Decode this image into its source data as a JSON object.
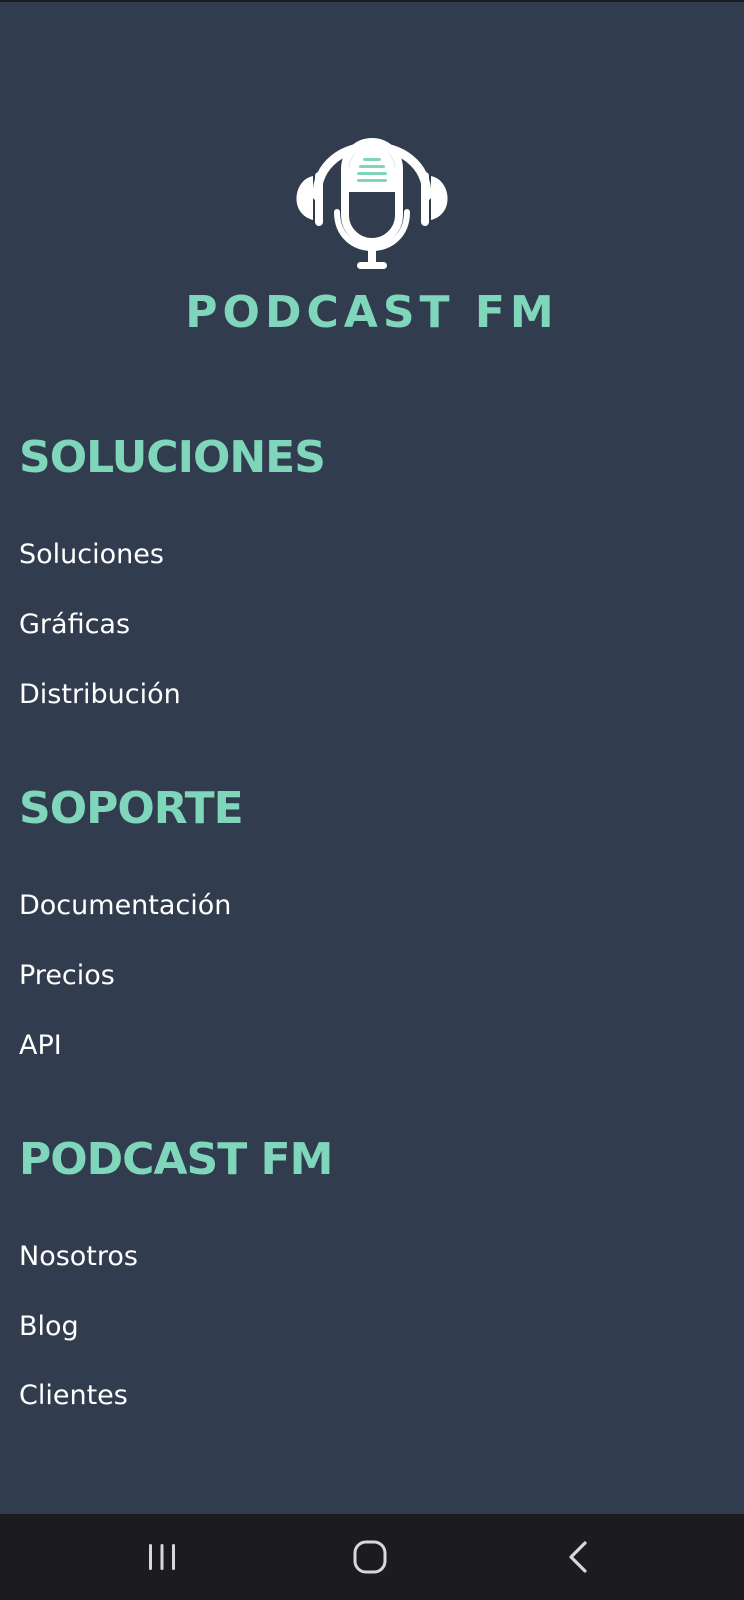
{
  "brand": {
    "name": "PODCAST FM",
    "logo_icon": "podcast-headphones-microphone-icon",
    "accent_color": "#7fd6bb"
  },
  "sections": [
    {
      "title": "SOLUCIONES",
      "links": [
        "Soluciones",
        "Gráficas",
        "Distribución"
      ]
    },
    {
      "title": "SOPORTE",
      "links": [
        "Documentación",
        "Precios",
        "API"
      ]
    },
    {
      "title": "PODCAST FM",
      "links": [
        "Nosotros",
        "Blog",
        "Clientes"
      ]
    }
  ],
  "system_nav": {
    "recents_icon": "recents-icon",
    "home_icon": "home-icon",
    "back_icon": "back-icon"
  },
  "colors": {
    "background": "#323c4f",
    "link_text": "#ffffff",
    "nav_bar": "#1c1c20"
  }
}
